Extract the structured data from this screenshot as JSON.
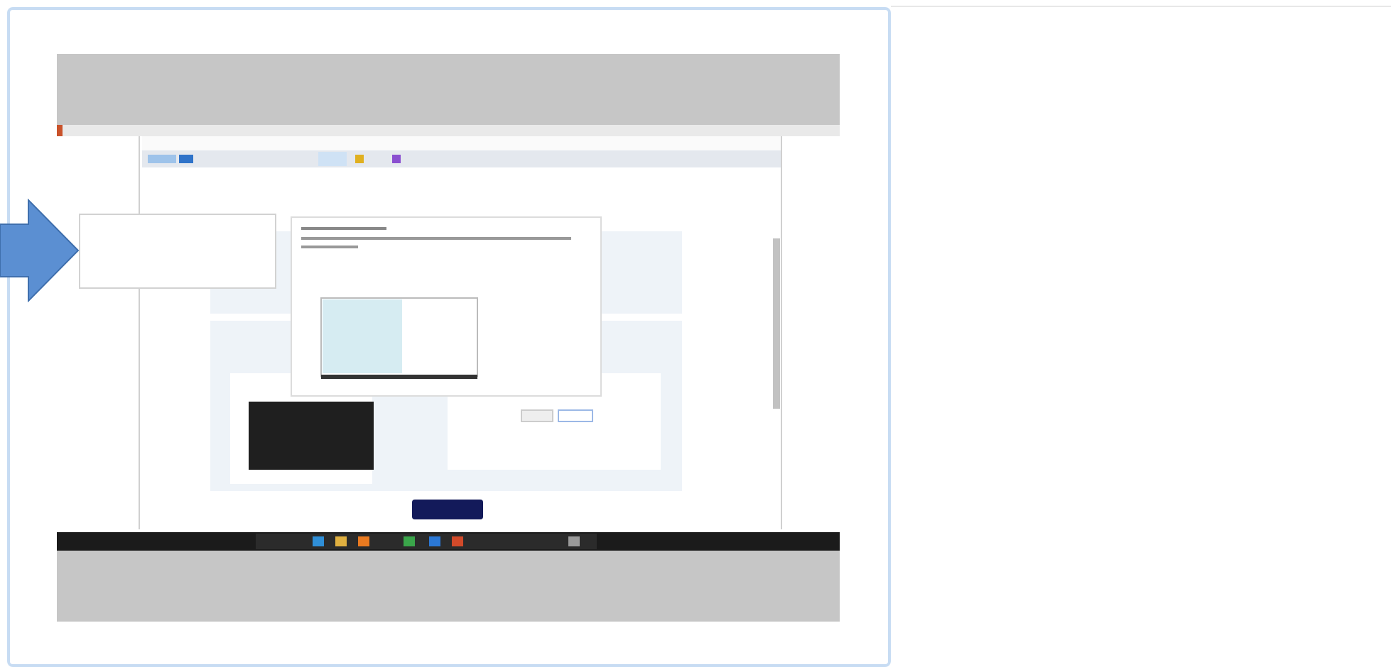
{
  "card": {
    "picture": {
      "kind": "screenshot"
    },
    "callout": {
      "kind": "arrow"
    }
  }
}
